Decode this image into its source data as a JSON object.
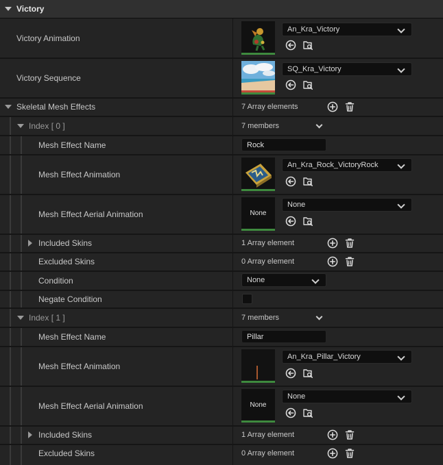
{
  "category": {
    "title": "Victory"
  },
  "victory_animation": {
    "label": "Victory Animation",
    "value": "An_Kra_Victory"
  },
  "victory_sequence": {
    "label": "Victory Sequence",
    "value": "SQ_Kra_Victory"
  },
  "skeletal_mesh_effects": {
    "label": "Skeletal Mesh Effects",
    "count": "7 Array elements"
  },
  "index0": {
    "label": "Index [ 0 ]",
    "members": "7 members",
    "mesh_effect_name_label": "Mesh Effect Name",
    "mesh_effect_name": "Rock",
    "mesh_effect_animation_label": "Mesh Effect Animation",
    "mesh_effect_animation": "An_Kra_Rock_VictoryRock",
    "aerial_label": "Mesh Effect Aerial Animation",
    "aerial_value": "None",
    "aerial_thumb": "None",
    "included_label": "Included Skins",
    "included_count": "1 Array element",
    "excluded_label": "Excluded Skins",
    "excluded_count": "0 Array element",
    "condition_label": "Condition",
    "condition_value": "None",
    "negate_label": "Negate Condition"
  },
  "index1": {
    "label": "Index [ 1 ]",
    "members": "7 members",
    "mesh_effect_name_label": "Mesh Effect Name",
    "mesh_effect_name": "Pillar",
    "mesh_effect_animation_label": "Mesh Effect Animation",
    "mesh_effect_animation": "An_Kra_Pillar_Victory",
    "aerial_label": "Mesh Effect Aerial Animation",
    "aerial_value": "None",
    "aerial_thumb": "None",
    "included_label": "Included Skins",
    "included_count": "1 Array element",
    "excluded_label": "Excluded Skins",
    "excluded_count": "0 Array element"
  },
  "icons": [
    "browse-back-icon",
    "find-in-browser-icon",
    "add-element-icon",
    "delete-all-icon",
    "chevron-down-icon",
    "expand-arrow-icon"
  ],
  "colors": {
    "thumb_underline": "#3e8a3e",
    "row_bg": "#242424",
    "category_bg": "#303030"
  }
}
